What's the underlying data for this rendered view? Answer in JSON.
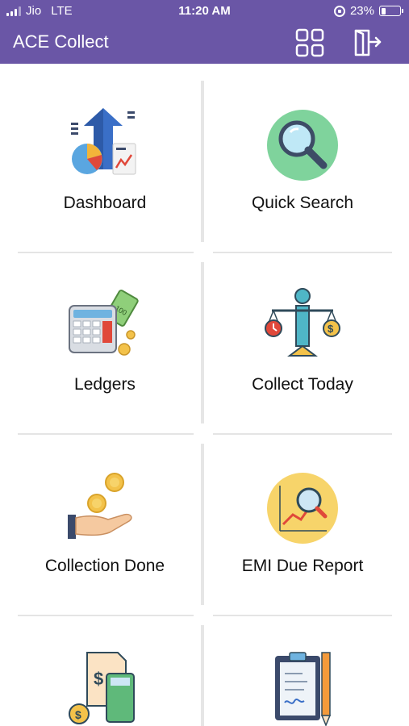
{
  "status_bar": {
    "carrier": "Jio",
    "network": "LTE",
    "time": "11:20 AM",
    "battery": "23%",
    "battery_level": 0.23
  },
  "header": {
    "title": "ACE Collect",
    "grid_icon": "grid-icon",
    "logout_icon": "logout-icon"
  },
  "tiles": [
    {
      "label": "Dashboard",
      "icon": "dashboard-chart-icon"
    },
    {
      "label": "Quick Search",
      "icon": "magnifier-icon"
    },
    {
      "label": "Ledgers",
      "icon": "calculator-cash-icon"
    },
    {
      "label": "Collect Today",
      "icon": "balance-scale-icon"
    },
    {
      "label": "Collection Done",
      "icon": "hand-coins-icon"
    },
    {
      "label": "EMI Due Report",
      "icon": "report-search-icon"
    },
    {
      "label": "",
      "icon": "bill-calculator-icon"
    },
    {
      "label": "",
      "icon": "clipboard-pencil-icon"
    }
  ],
  "colors": {
    "header": "#6a56a6",
    "text": "#111111",
    "divider": "#e4e4e4"
  }
}
